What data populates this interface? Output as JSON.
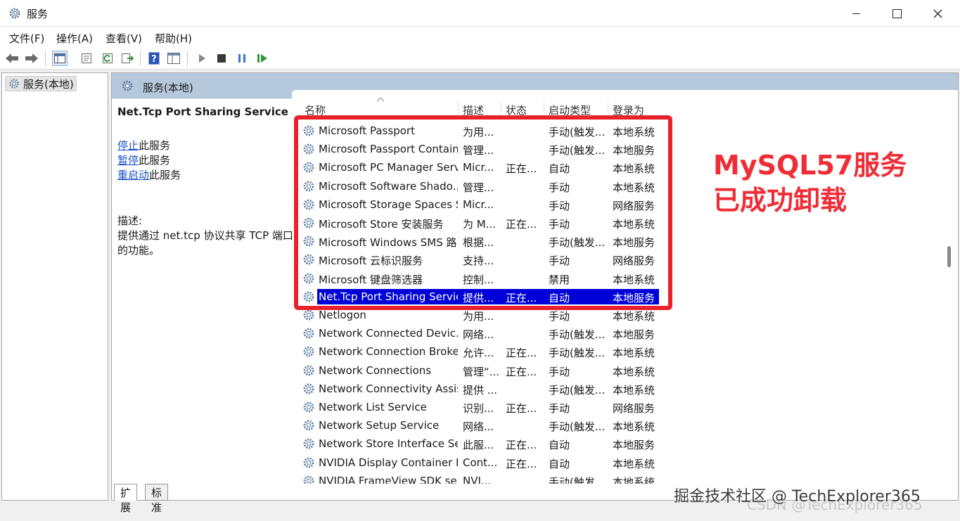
{
  "window": {
    "title": "服务"
  },
  "menu": [
    "文件(F)",
    "操作(A)",
    "查看(V)",
    "帮助(H)"
  ],
  "toolbar": [
    "back-icon",
    "forward-icon",
    "show-hide-tree-icon",
    "properties-icon",
    "refresh-icon",
    "export-list-icon",
    "help-icon",
    "view-icon",
    "start-icon",
    "stop-icon",
    "pause-icon",
    "resume-icon"
  ],
  "tree": {
    "root_label": "服务(本地)"
  },
  "panel": {
    "header": "服务(本地)",
    "service_title": "Net.Tcp Port Sharing Service",
    "actions": [
      {
        "link": "停止",
        "suffix": "此服务"
      },
      {
        "link": "暂停",
        "suffix": "此服务"
      },
      {
        "link": "重启动",
        "suffix": "此服务"
      }
    ],
    "desc_label": "描述:",
    "desc_text_1": "提供通过 net.tcp 协议共享 TCP 端口",
    "desc_text_2": "的功能。"
  },
  "columns": {
    "name": "名称",
    "desc": "描述",
    "status": "状态",
    "startup": "启动类型",
    "logon": "登录为"
  },
  "rows": [
    {
      "name": "Microsoft Passport",
      "desc": "为用...",
      "status": "",
      "startup": "手动(触发...",
      "logon": "本地系统"
    },
    {
      "name": "Microsoft Passport Container",
      "desc": "管理...",
      "status": "",
      "startup": "手动(触发...",
      "logon": "本地服务"
    },
    {
      "name": "Microsoft PC Manager Serv...",
      "desc": "Micr...",
      "status": "正在...",
      "startup": "自动",
      "logon": "本地系统"
    },
    {
      "name": "Microsoft Software Shado...",
      "desc": "管理...",
      "status": "",
      "startup": "手动",
      "logon": "本地系统"
    },
    {
      "name": "Microsoft Storage Spaces S...",
      "desc": "Micr...",
      "status": "",
      "startup": "手动",
      "logon": "网络服务"
    },
    {
      "name": "Microsoft Store 安装服务",
      "desc": "为 M...",
      "status": "正在...",
      "startup": "手动",
      "logon": "本地系统"
    },
    {
      "name": "Microsoft Windows SMS 路...",
      "desc": "根据...",
      "status": "",
      "startup": "手动(触发...",
      "logon": "本地服务"
    },
    {
      "name": "Microsoft 云标识服务",
      "desc": "支持...",
      "status": "",
      "startup": "手动",
      "logon": "网络服务"
    },
    {
      "name": "Microsoft 键盘筛选器",
      "desc": "控制...",
      "status": "",
      "startup": "禁用",
      "logon": "本地系统"
    },
    {
      "name": "Net.Tcp Port Sharing Service",
      "desc": "提供...",
      "status": "正在...",
      "startup": "自动",
      "logon": "本地服务",
      "selected": true
    },
    {
      "name": "Netlogon",
      "desc": "为用...",
      "status": "",
      "startup": "手动",
      "logon": "本地系统"
    },
    {
      "name": "Network Connected Devic...",
      "desc": "网络...",
      "status": "",
      "startup": "手动(触发...",
      "logon": "本地服务"
    },
    {
      "name": "Network Connection Broker",
      "desc": "允许...",
      "status": "正在...",
      "startup": "手动(触发...",
      "logon": "本地系统"
    },
    {
      "name": "Network Connections",
      "desc": "管理“...",
      "status": "正在...",
      "startup": "手动",
      "logon": "本地系统"
    },
    {
      "name": "Network Connectivity Assis...",
      "desc": "提供 ...",
      "status": "",
      "startup": "手动(触发...",
      "logon": "本地系统"
    },
    {
      "name": "Network List Service",
      "desc": "识别...",
      "status": "正在...",
      "startup": "手动",
      "logon": "网络服务"
    },
    {
      "name": "Network Setup Service",
      "desc": "网络...",
      "status": "",
      "startup": "手动(触发...",
      "logon": "本地系统"
    },
    {
      "name": "Network Store Interface Se...",
      "desc": "此服...",
      "status": "正在...",
      "startup": "自动",
      "logon": "本地服务"
    },
    {
      "name": "NVIDIA Display Container LS",
      "desc": "Cont...",
      "status": "正在...",
      "startup": "自动",
      "logon": "本地系统"
    },
    {
      "name": "NVIDIA FrameView SDK se...",
      "desc": "NVI...",
      "status": "",
      "startup": "手动(触发...",
      "logon": "本地系统"
    }
  ],
  "annotation": {
    "line1": "MySQL57服务",
    "line2": "已成功卸载"
  },
  "tabs": [
    "扩展",
    "标准"
  ],
  "watermark": {
    "main": "掘金技术社区 @ TechExplorer365",
    "faint": "CSDN @TechExplorer365"
  },
  "colors": {
    "selection": "#0000d8",
    "highlight_box": "#e8212a",
    "annotation": "#ef2d37",
    "header_band": "#b6c9dc"
  }
}
